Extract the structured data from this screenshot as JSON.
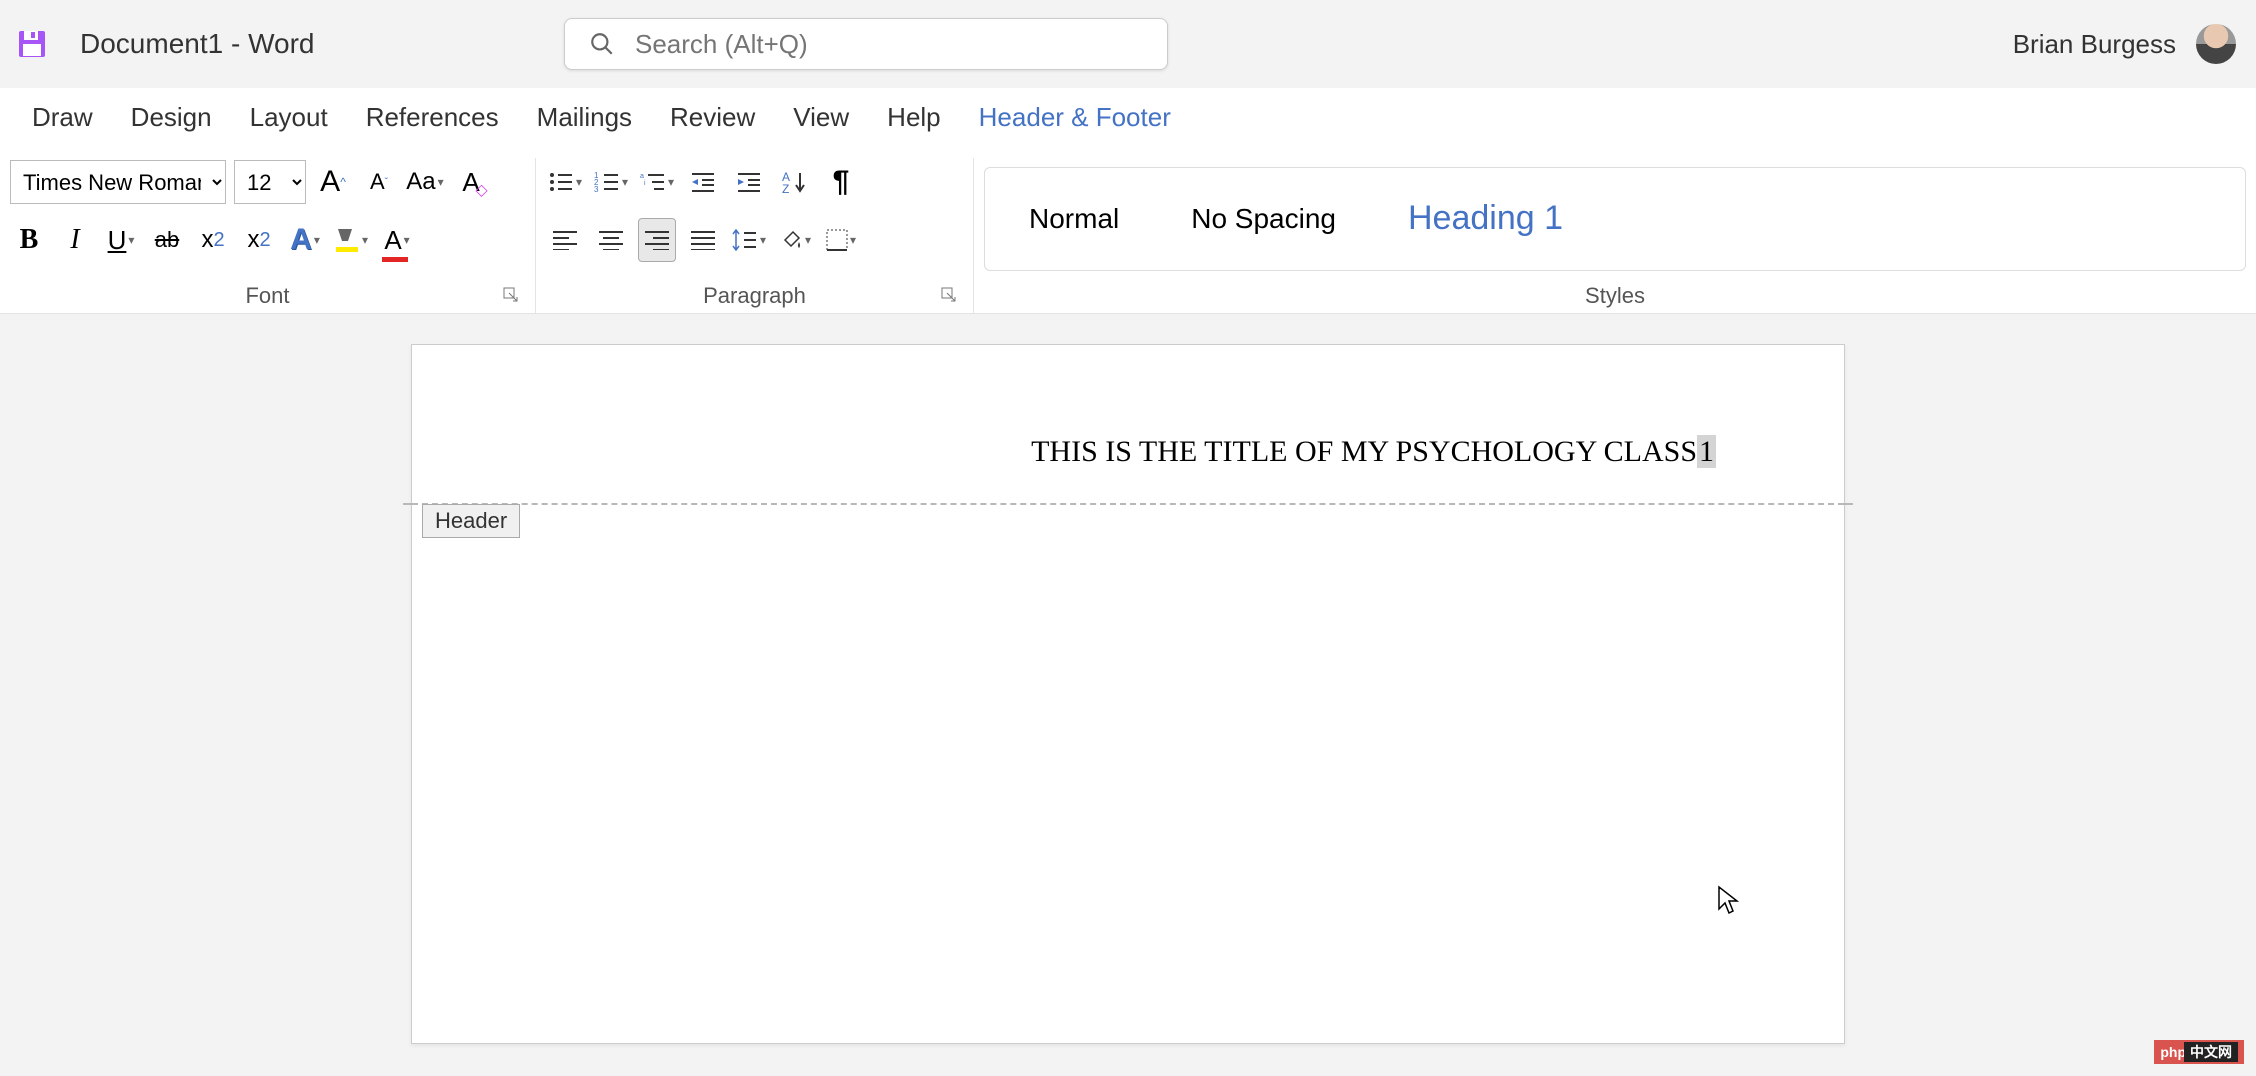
{
  "titlebar": {
    "document_title": "Document1  -  Word",
    "search_placeholder": "Search (Alt+Q)",
    "user_name": "Brian Burgess"
  },
  "tabs": {
    "items": [
      "Draw",
      "Design",
      "Layout",
      "References",
      "Mailings",
      "Review",
      "View",
      "Help",
      "Header & Footer"
    ],
    "active_index": 8
  },
  "ribbon": {
    "font": {
      "name": "Times New Roman",
      "size": "12",
      "grow_label": "A",
      "shrink_label": "A",
      "case_label": "Aa",
      "group_label": "Font"
    },
    "paragraph": {
      "group_label": "Paragraph"
    },
    "styles": {
      "items": [
        "Normal",
        "No Spacing",
        "Heading 1"
      ],
      "group_label": "Styles"
    }
  },
  "document": {
    "header_text": "THIS IS THE TITLE OF MY PSYCHOLOGY CLASS",
    "page_number": "1",
    "header_label": "Header"
  },
  "watermark": {
    "left": "php",
    "right": "中文网"
  },
  "colors": {
    "accent": "#4472c4",
    "highlight": "#ffeb00",
    "font_color": "#e32525"
  }
}
